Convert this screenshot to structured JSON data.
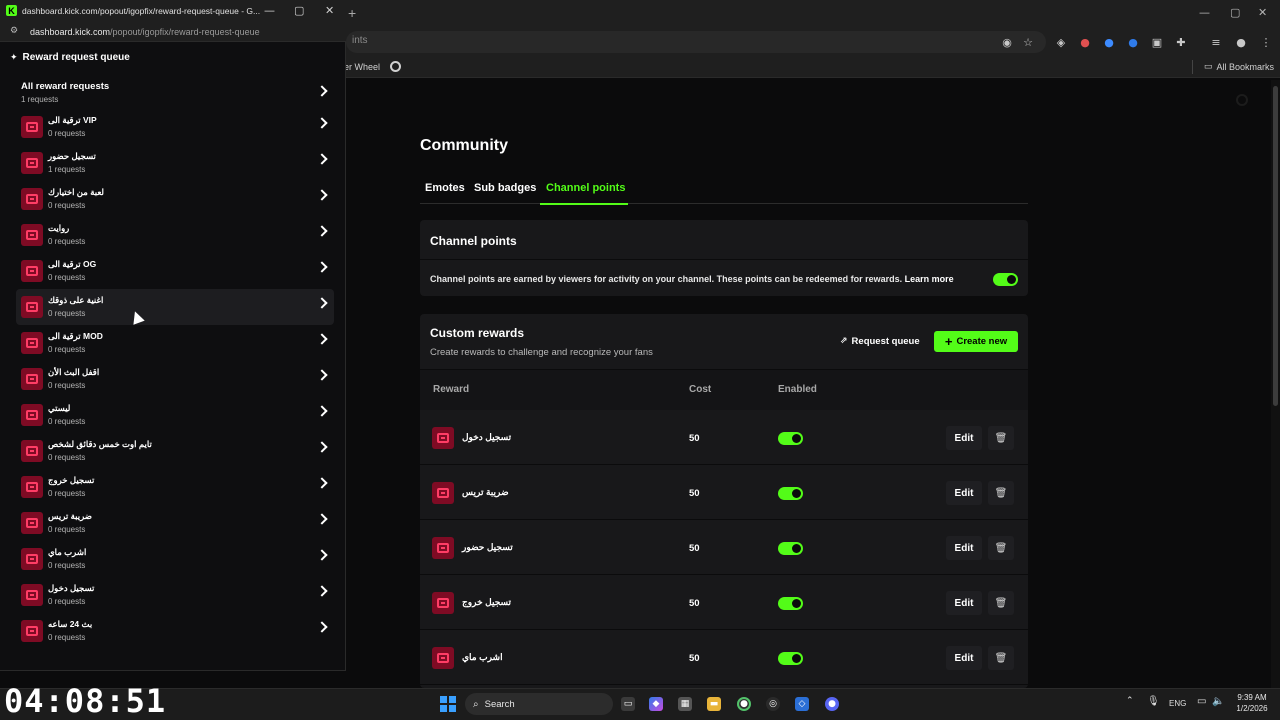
{
  "timer": "04:08:51",
  "background_browser": {
    "omnibox_partial": "ints",
    "bookmark_partial": "er Wheel",
    "all_bookmarks": "All Bookmarks"
  },
  "popout": {
    "window_title": "dashboard.kick.com/popout/igopfix/reward-request-queue - G...",
    "url_host": "dashboard.kick.com",
    "url_path": "/popout/igopfix/reward-request-queue",
    "header": "Reward request queue",
    "all": {
      "title": "All reward requests",
      "count": "1 requests"
    },
    "items": [
      {
        "name": "ترقية الى VIP",
        "count": "0 requests"
      },
      {
        "name": "تسجيل حضور",
        "count": "1 requests"
      },
      {
        "name": "لعبة من اختيارك",
        "count": "0 requests"
      },
      {
        "name": "روايت",
        "count": "0 requests"
      },
      {
        "name": "ترقية الى OG",
        "count": "0 requests"
      },
      {
        "name": "اغنية على ذوقك",
        "count": "0 requests"
      },
      {
        "name": "ترقية الى MOD",
        "count": "0 requests"
      },
      {
        "name": "اقفل البث الأن",
        "count": "0 requests"
      },
      {
        "name": "ليستي",
        "count": "0 requests"
      },
      {
        "name": "تايم اوت خمس دقائق لشخص",
        "count": "0 requests"
      },
      {
        "name": "تسجيل خروج",
        "count": "0 requests"
      },
      {
        "name": "ضريبة تريس",
        "count": "0 requests"
      },
      {
        "name": "اشرب ماي",
        "count": "0 requests"
      },
      {
        "name": "تسجيل دخول",
        "count": "0 requests"
      },
      {
        "name": "بث 24 ساعه",
        "count": "0 requests"
      }
    ]
  },
  "main": {
    "title": "Community",
    "tabs": [
      "Emotes",
      "Sub badges",
      "Channel points"
    ],
    "active_tab": "Channel points",
    "channel_points": {
      "title": "Channel points",
      "description": "Channel points are earned by viewers for activity on your channel. These points can be redeemed for rewards.",
      "learn_more": "Learn more",
      "enabled": true
    },
    "custom_rewards": {
      "title": "Custom rewards",
      "subtitle": "Create rewards to challenge and recognize your fans",
      "request_queue_label": "Request queue",
      "create_new_label": "Create new",
      "columns": [
        "Reward",
        "Cost",
        "Enabled"
      ],
      "rows": [
        {
          "name": "تسجيل دخول",
          "cost": "50",
          "enabled": true,
          "edit": "Edit"
        },
        {
          "name": "ضريبة تريس",
          "cost": "50",
          "enabled": true,
          "edit": "Edit"
        },
        {
          "name": "تسجيل حضور",
          "cost": "50",
          "enabled": true,
          "edit": "Edit"
        },
        {
          "name": "تسجيل خروج",
          "cost": "50",
          "enabled": true,
          "edit": "Edit"
        },
        {
          "name": "اشرب ماي",
          "cost": "50",
          "enabled": true,
          "edit": "Edit"
        }
      ]
    }
  },
  "taskbar": {
    "search_label": "Search",
    "language": "ENG",
    "time": "9:39 AM",
    "date": "1/2/2026"
  },
  "colors": {
    "accent": "#53fc18",
    "reward_icon_bg": "#7e0b24",
    "reward_icon_fg": "#ff3d66"
  }
}
